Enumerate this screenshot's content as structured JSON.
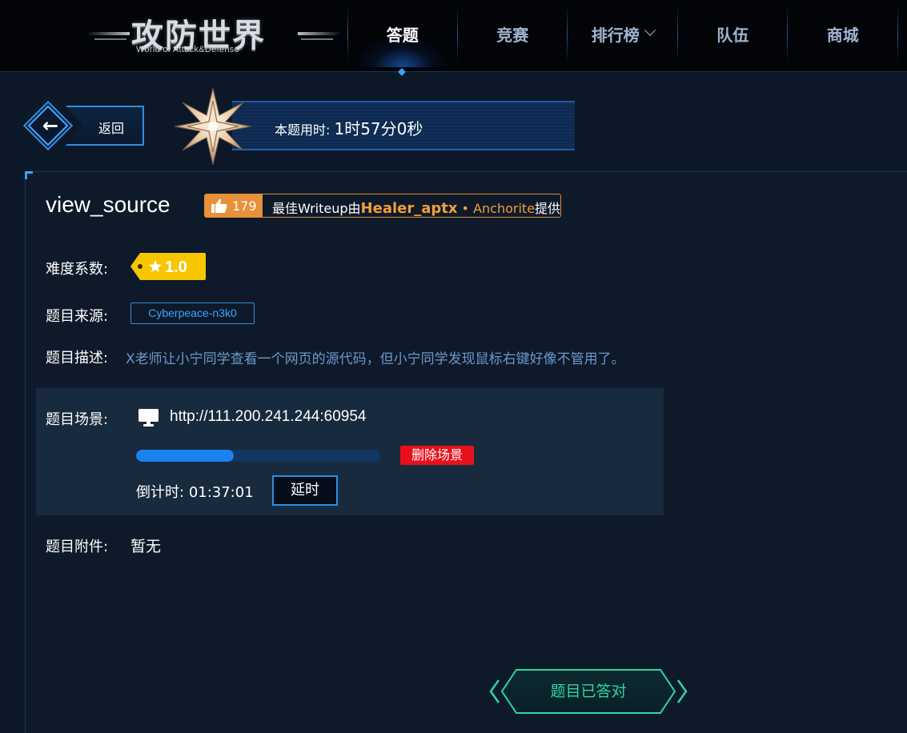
{
  "logo": {
    "title": "攻防世界",
    "subtitle": "World of Attack&Defense"
  },
  "nav": {
    "items": [
      {
        "label": "答题",
        "active": true
      },
      {
        "label": "竞赛",
        "active": false
      },
      {
        "label": "排行榜",
        "active": false,
        "dropdown": true
      },
      {
        "label": "队伍",
        "active": false
      },
      {
        "label": "商城",
        "active": false
      }
    ]
  },
  "back": {
    "label": "返回"
  },
  "timer": {
    "label": "本题用时: ",
    "value": "1时57分0秒"
  },
  "challenge": {
    "title": "view_source",
    "likes": "179",
    "writeup_prefix": "最佳Writeup由",
    "writeup_author": "Healer_aptx",
    "writeup_sep": " • ",
    "writeup_team": "Anchorite",
    "writeup_suffix": "提供",
    "difficulty_label": "难度系数:",
    "difficulty_value": "1.0",
    "source_label": "题目来源:",
    "source_value": "Cyberpeace-n3k0",
    "desc_label": "题目描述:",
    "desc_value": "X老师让小宁同学查看一个网页的源代码，但小宁同学发现鼠标右键好像不管用了。",
    "scene_label": "题目场景:",
    "scene_url": "http://111.200.241.244:60954",
    "scene_progress": 0.4,
    "delete_label": "删除场景",
    "countdown_label": "倒计时:",
    "countdown_value": "01:37:01",
    "extend_label": "延时",
    "attach_label": "题目附件:",
    "attach_value": "暂无",
    "solved_label": "题目已答对"
  },
  "colors": {
    "accent": "#2f8ee0",
    "writeup": "#e7913a",
    "difficulty": "#f7c600",
    "delete": "#e8101a",
    "solved": "#2fd6a0",
    "description": "#6c97c9"
  },
  "icons": [
    "arrow-left-icon",
    "star-badge-icon",
    "thumbs-up-icon",
    "star-icon",
    "monitor-icon",
    "chevron-down-icon"
  ]
}
